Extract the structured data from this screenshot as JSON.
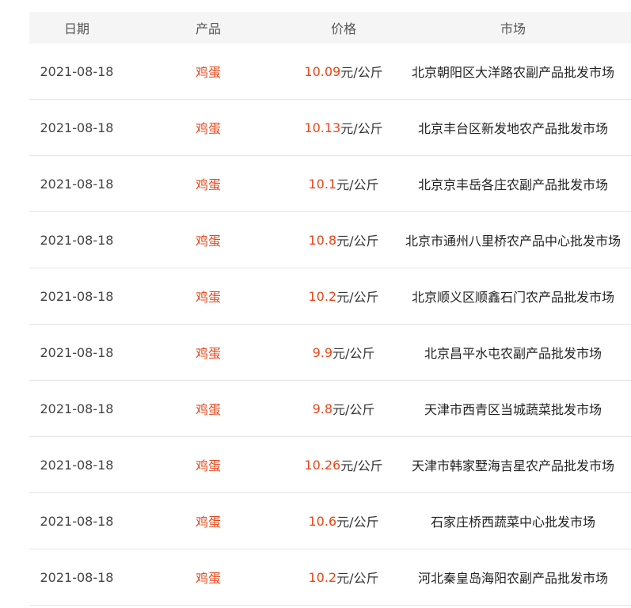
{
  "table": {
    "headers": {
      "date": "日期",
      "product": "产品",
      "price": "价格",
      "market": "市场"
    },
    "price_unit": "元/公斤",
    "rows": [
      {
        "date": "2021-08-18",
        "product": "鸡蛋",
        "price": "10.09",
        "market": "北京朝阳区大洋路农副产品批发市场"
      },
      {
        "date": "2021-08-18",
        "product": "鸡蛋",
        "price": "10.13",
        "market": "北京丰台区新发地农产品批发市场"
      },
      {
        "date": "2021-08-18",
        "product": "鸡蛋",
        "price": "10.1",
        "market": "北京京丰岳各庄农副产品批发市场"
      },
      {
        "date": "2021-08-18",
        "product": "鸡蛋",
        "price": "10.8",
        "market": "北京市通州八里桥农产品中心批发市场"
      },
      {
        "date": "2021-08-18",
        "product": "鸡蛋",
        "price": "10.2",
        "market": "北京顺义区顺鑫石门农产品批发市场"
      },
      {
        "date": "2021-08-18",
        "product": "鸡蛋",
        "price": "9.9",
        "market": "北京昌平水屯农副产品批发市场"
      },
      {
        "date": "2021-08-18",
        "product": "鸡蛋",
        "price": "9.8",
        "market": "天津市西青区当城蔬菜批发市场"
      },
      {
        "date": "2021-08-18",
        "product": "鸡蛋",
        "price": "10.26",
        "market": "天津市韩家墅海吉星农产品批发市场"
      },
      {
        "date": "2021-08-18",
        "product": "鸡蛋",
        "price": "10.6",
        "market": "石家庄桥西蔬菜中心批发市场"
      },
      {
        "date": "2021-08-18",
        "product": "鸡蛋",
        "price": "10.2",
        "market": "河北秦皇岛海阳农副产品批发市场"
      }
    ]
  },
  "colors": {
    "accent": "#e8471b",
    "header_bg": "#f5f5f5",
    "row_border": "#e5e5e5"
  }
}
